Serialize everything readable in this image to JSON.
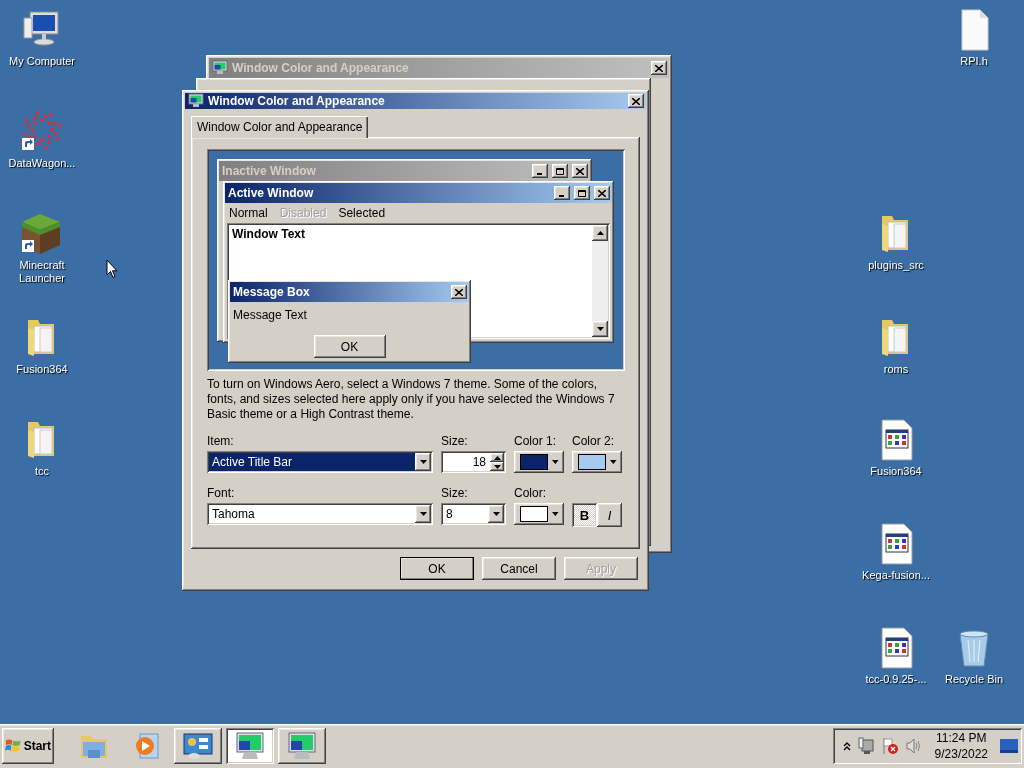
{
  "desktop_icons": [
    {
      "label": "My Computer",
      "kind": "computer",
      "shortcut": false
    },
    {
      "label": "DataWagon...",
      "kind": "dots",
      "shortcut": true
    },
    {
      "label": "Minecraft Launcher",
      "kind": "block",
      "shortcut": true
    },
    {
      "label": "Fusion364",
      "kind": "folder",
      "shortcut": false
    },
    {
      "label": "tcc",
      "kind": "folder",
      "shortcut": false
    },
    {
      "label": "RPI.h",
      "kind": "file",
      "shortcut": false
    },
    {
      "label": "plugins_src",
      "kind": "folder",
      "shortcut": false
    },
    {
      "label": "roms",
      "kind": "folder",
      "shortcut": false
    },
    {
      "label": "Fusion364",
      "kind": "program",
      "shortcut": false
    },
    {
      "label": "Kega-fusion...",
      "kind": "program",
      "shortcut": false
    },
    {
      "label": "tcc-0.9.25-...",
      "kind": "program",
      "shortcut": false
    },
    {
      "label": "Recycle Bin",
      "kind": "bin",
      "shortcut": false
    }
  ],
  "back_window": {
    "title": "Window Color and Appearance",
    "active": false
  },
  "dialog": {
    "title": "Window Color and Appearance",
    "active": true,
    "tabs": [
      {
        "label": "Window Color and Appearance",
        "selected": true
      }
    ],
    "preview": {
      "inactive_title": "Inactive Window",
      "active_title": "Active Window",
      "menu": [
        {
          "label": "Normal",
          "disabled": false
        },
        {
          "label": "Disabled",
          "disabled": true
        },
        {
          "label": "Selected",
          "disabled": false
        }
      ],
      "window_text": "Window Text",
      "message_box": {
        "title": "Message Box",
        "text": "Message Text",
        "button": "OK"
      }
    },
    "description": "To turn on Windows Aero, select a Windows 7 theme.  Some of the colors, fonts, and sizes selected here apply only if you have selected the Windows 7 Basic theme or a High Contrast theme.",
    "item": {
      "label": "Item:",
      "value": "Active Title Bar"
    },
    "item_size": {
      "label": "Size:",
      "value": "18"
    },
    "color1": {
      "label": "Color 1:",
      "color": "#0a246a"
    },
    "color2": {
      "label": "Color 2:",
      "color": "#a6caf0"
    },
    "font": {
      "label": "Font:",
      "value": "Tahoma"
    },
    "font_size": {
      "label": "Size:",
      "value": "8"
    },
    "font_color": {
      "label": "Color:",
      "color": "#ffffff"
    },
    "bold": {
      "label": "B",
      "on": true
    },
    "italic": {
      "label": "I",
      "on": false
    },
    "buttons": [
      {
        "label": "OK",
        "default": true,
        "disabled": false
      },
      {
        "label": "Cancel",
        "default": false,
        "disabled": false
      },
      {
        "label": "Apply",
        "default": false,
        "disabled": true
      }
    ]
  },
  "taskbar": {
    "start": "Start",
    "buttons": [
      {
        "kind": "explorer",
        "running": false,
        "selected": false
      },
      {
        "kind": "media",
        "running": false,
        "selected": false
      },
      {
        "kind": "control-panel",
        "running": true,
        "selected": false
      },
      {
        "kind": "display",
        "running": true,
        "selected": true
      },
      {
        "kind": "display",
        "running": true,
        "selected": false
      }
    ],
    "tray": {
      "time": "11:24 PM",
      "date": "9/23/2022"
    }
  }
}
